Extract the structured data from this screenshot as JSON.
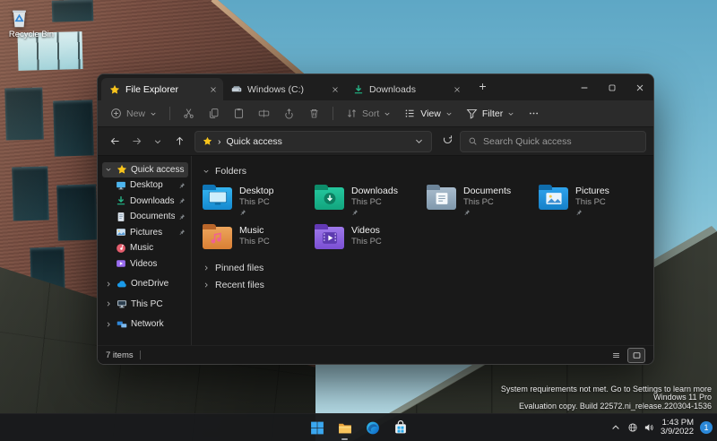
{
  "desktop": {
    "icons": [
      {
        "label": "Recycle Bin",
        "icon": "recycle-bin"
      }
    ]
  },
  "window": {
    "caption_controls": [
      {
        "name": "minimize",
        "icon": "minimize"
      },
      {
        "name": "maximize",
        "icon": "maximize"
      },
      {
        "name": "close",
        "icon": "close"
      }
    ],
    "tabs": [
      {
        "label": "File Explorer",
        "icon": "star",
        "active": true
      },
      {
        "label": "Windows (C:)",
        "icon": "drive",
        "active": false
      },
      {
        "label": "Downloads",
        "icon": "download",
        "active": false
      }
    ],
    "new_tab_icon": "plus",
    "toolbar": [
      {
        "name": "new",
        "label": "New",
        "icon": "plus-circle",
        "chevron": true,
        "enabled": false
      },
      {
        "separator": true
      },
      {
        "name": "cut",
        "icon": "scissors",
        "enabled": false
      },
      {
        "name": "copy",
        "icon": "copy",
        "enabled": false
      },
      {
        "name": "paste",
        "icon": "clipboard",
        "enabled": false
      },
      {
        "name": "rename",
        "icon": "rename",
        "enabled": false
      },
      {
        "name": "share",
        "icon": "share",
        "enabled": false
      },
      {
        "name": "delete",
        "icon": "trash",
        "enabled": false
      },
      {
        "separator": true
      },
      {
        "name": "sort",
        "label": "Sort",
        "icon": "sort-arrows",
        "chevron": true,
        "enabled": false
      },
      {
        "name": "view",
        "label": "View",
        "icon": "view-list",
        "chevron": true,
        "enabled": true
      },
      {
        "name": "filter",
        "label": "Filter",
        "icon": "funnel",
        "chevron": true,
        "enabled": true
      },
      {
        "name": "more",
        "icon": "ellipsis",
        "enabled": true
      }
    ],
    "address": {
      "nav": [
        {
          "name": "back",
          "icon": "arrow-left"
        },
        {
          "name": "forward",
          "icon": "arrow-right"
        },
        {
          "name": "recent-locations",
          "icon": "chevron-down",
          "small": true
        },
        {
          "name": "up",
          "icon": "arrow-up"
        }
      ],
      "breadcrumb_icon": "star",
      "breadcrumb_separator": "›",
      "breadcrumb": "Quick access",
      "dropdown_icon": "chevron-down",
      "refresh_icon": "refresh",
      "search_icon": "search",
      "search_placeholder": "Search Quick access"
    },
    "sidebar": [
      {
        "label": "Quick access",
        "icon": "star",
        "chevron": "down",
        "selected": true,
        "group": true
      },
      {
        "label": "Desktop",
        "icon": "monitor",
        "pinned": true,
        "child": true
      },
      {
        "label": "Downloads",
        "icon": "download",
        "pinned": true,
        "child": true
      },
      {
        "label": "Documents",
        "icon": "document",
        "pinned": true,
        "child": true
      },
      {
        "label": "Pictures",
        "icon": "picture",
        "pinned": true,
        "child": true
      },
      {
        "label": "Music",
        "icon": "music",
        "child": true
      },
      {
        "label": "Videos",
        "icon": "video",
        "child": true
      },
      {
        "label": "OneDrive",
        "icon": "cloud",
        "chevron": "right",
        "group": true
      },
      {
        "label": "This PC",
        "icon": "pc",
        "chevron": "right",
        "group": true
      },
      {
        "label": "Network",
        "icon": "network",
        "chevron": "right",
        "group": true
      }
    ],
    "content": {
      "folders_section": {
        "label": "Folders",
        "expanded": true
      },
      "tiles": [
        {
          "name": "Desktop",
          "sub": "This PC",
          "icon": "desktop",
          "pinned": true
        },
        {
          "name": "Downloads",
          "sub": "This PC",
          "icon": "downloads",
          "pinned": true
        },
        {
          "name": "Documents",
          "sub": "This PC",
          "icon": "documents",
          "pinned": true
        },
        {
          "name": "Pictures",
          "sub": "This PC",
          "icon": "pictures",
          "pinned": true
        },
        {
          "name": "Music",
          "sub": "This PC",
          "icon": "music",
          "pinned": false
        },
        {
          "name": "Videos",
          "sub": "This PC",
          "icon": "videos",
          "pinned": false
        }
      ],
      "collapsed_sections": [
        {
          "label": "Pinned files"
        },
        {
          "label": "Recent files"
        }
      ]
    },
    "statusbar": {
      "items_text": "7 items",
      "view_buttons": [
        {
          "name": "details-view",
          "icon": "list",
          "active": false
        },
        {
          "name": "large-icons-view",
          "icon": "thumb",
          "active": true
        }
      ]
    }
  },
  "taskbar": {
    "buttons": [
      {
        "name": "start",
        "icon": "windows"
      },
      {
        "name": "file-explorer",
        "icon": "explorer",
        "active": true
      },
      {
        "name": "edge",
        "icon": "edge"
      },
      {
        "name": "store",
        "icon": "store"
      }
    ],
    "tray": {
      "hidden_icons_icon": "chevron-up",
      "status_icons": [
        {
          "name": "network",
          "icon": "globe"
        },
        {
          "name": "volume",
          "icon": "speaker"
        }
      ],
      "time": "1:43 PM",
      "date": "3/9/2022",
      "notification_count": "1"
    }
  },
  "watermark": {
    "line1": "System requirements not met. Go to Settings to learn more",
    "line2": "Windows 11 Pro",
    "line3": "Evaluation copy. Build 22572.ni_release.220304-1536"
  },
  "colors": {
    "accent_gold": "#f8c41c",
    "window_bg": "#191919",
    "toolbar_bg": "#2b2b2b",
    "badge_blue": "#2b88d8"
  }
}
